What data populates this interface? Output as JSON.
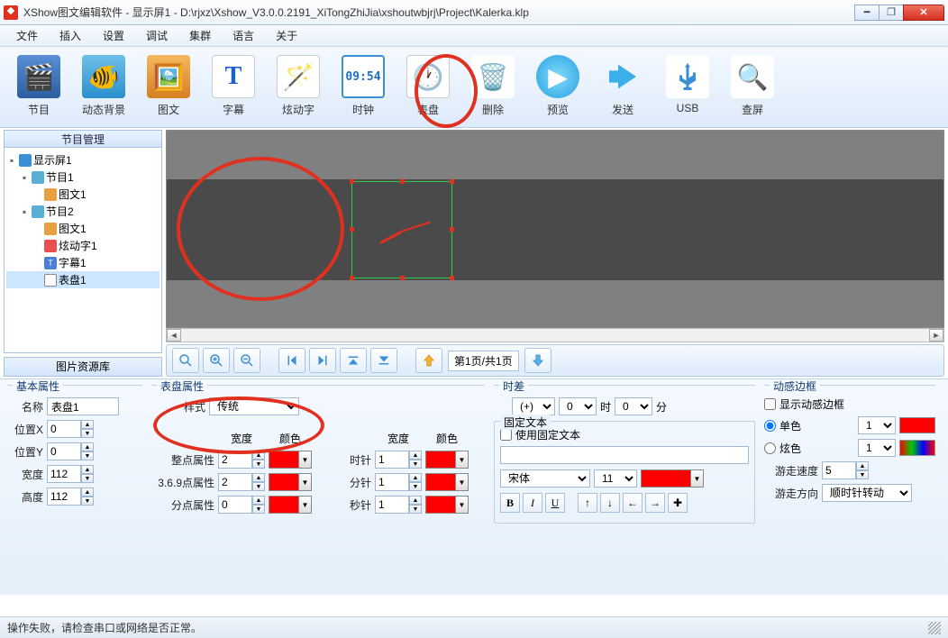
{
  "window": {
    "title": "XShow图文编辑软件 - 显示屏1 - D:\\rjxz\\Xshow_V3.0.0.2191_XiTongZhiJia\\xshoutwbjrj\\Project\\Kalerka.klp"
  },
  "menu": {
    "file": "文件",
    "insert": "插入",
    "settings": "设置",
    "debug": "调试",
    "cluster": "集群",
    "language": "语言",
    "about": "关于"
  },
  "tools": {
    "program": "节目",
    "dynbg": "动态背景",
    "pictext": "图文",
    "subtitle": "字幕",
    "fancytext": "炫动字",
    "clock": "时钟",
    "dial": "表盘",
    "delete": "删除",
    "preview": "预览",
    "send": "发送",
    "usb": "USB",
    "screen": "查屏"
  },
  "sidebar": {
    "title": "节目管理",
    "reslib": "图片资源库",
    "nodes": {
      "screen1": "显示屏1",
      "prog1": "节目1",
      "pic1": "图文1",
      "prog2": "节目2",
      "pic1b": "图文1",
      "fancy1": "炫动字1",
      "sub1": "字幕1",
      "dial1": "表盘1"
    }
  },
  "pager": {
    "info": "第1页/共1页"
  },
  "basic": {
    "title": "基本属性",
    "name_l": "名称",
    "name_v": "表盘1",
    "posx_l": "位置X",
    "posx_v": "0",
    "posy_l": "位置Y",
    "posy_v": "0",
    "w_l": "宽度",
    "w_v": "112",
    "h_l": "高度",
    "h_v": "112"
  },
  "dialprops": {
    "title": "表盘属性",
    "style_l": "样式",
    "style_v": "传统",
    "hdr_w": "宽度",
    "hdr_c": "颜色",
    "hour_l": "整点属性",
    "hour_v": "2",
    "q_l": "3.6.9点属性",
    "q_v": "2",
    "min_l": "分点属性",
    "min_v": "0",
    "hdr2_w": "宽度",
    "hdr2_c": "颜色",
    "hh_l": "时针",
    "hh_v": "1",
    "mh_l": "分针",
    "mh_v": "1",
    "sh_l": "秒针",
    "sh_v": "1"
  },
  "timediff": {
    "title": "时差",
    "mode": "(+)",
    "hours": "0",
    "h_suf": "时",
    "mins": "0",
    "m_suf": "分",
    "fixed_title": "固定文本",
    "use_fixed": "使用固定文本",
    "font": "宋体",
    "size": "11",
    "b": "B",
    "i": "I",
    "u": "U"
  },
  "border": {
    "title": "动感边框",
    "show": "显示动感边框",
    "single": "单色",
    "single_v": "1",
    "fancy": "炫色",
    "fancy_v": "1",
    "speed_l": "游走速度",
    "speed_v": "5",
    "dir_l": "游走方向",
    "dir_v": "顺时针转动"
  },
  "status": "操作失败，请检查串口或网络是否正常。"
}
